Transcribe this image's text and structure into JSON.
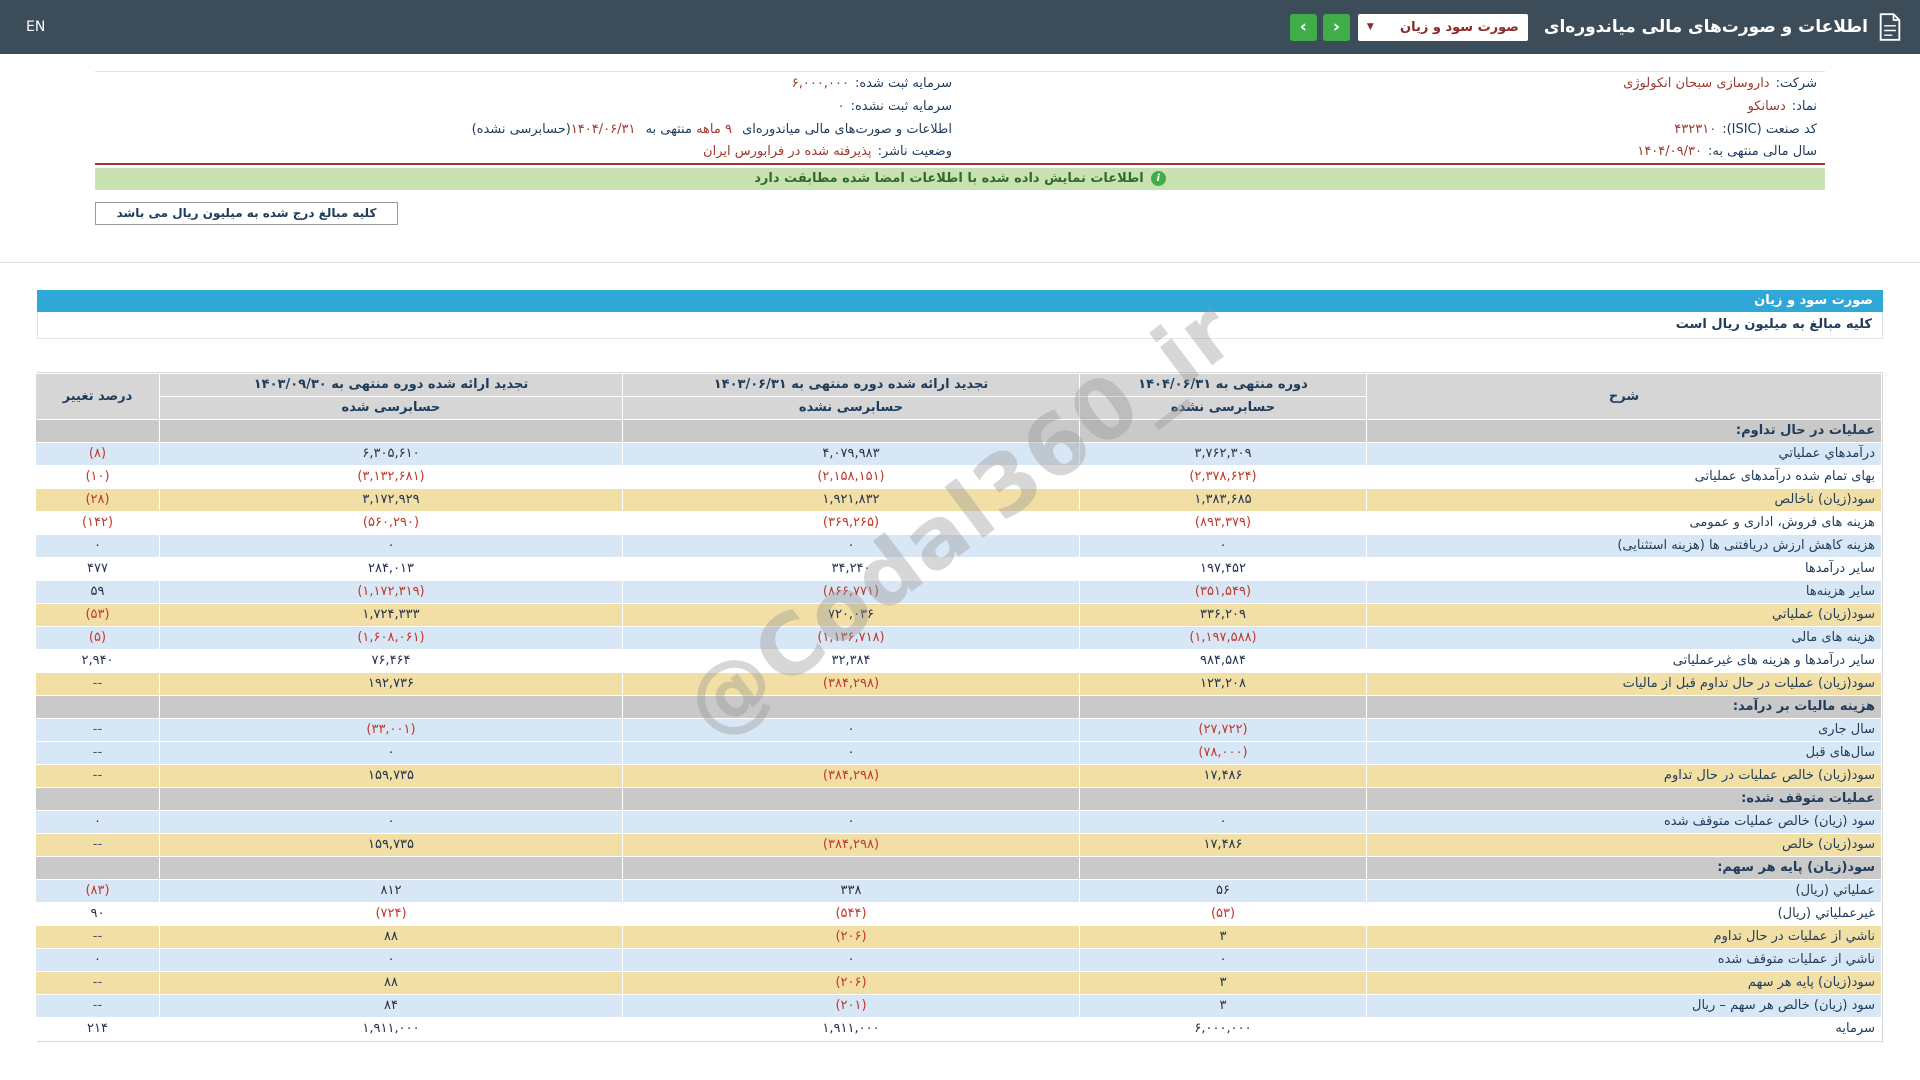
{
  "topbar": {
    "title": "اطلاعات و صورت‌های مالی میاندوره‌ای",
    "dropdown_value": "صورت سود و زیان",
    "lang": "EN"
  },
  "icons": {
    "caret_down": "▼",
    "chevron_left": "‹",
    "chevron_right": "›",
    "info": "i"
  },
  "info_rows": [
    {
      "right": {
        "label": "شرکت:",
        "value": "داروسازی سبحان انکولوژی"
      },
      "left": {
        "label": "سرمایه ثبت شده:",
        "value": "۶,۰۰۰,۰۰۰"
      }
    },
    {
      "right": {
        "label": "نماد:",
        "value": "دسانکو"
      },
      "left": {
        "label": "سرمایه ثبت نشده:",
        "value": "۰"
      }
    },
    {
      "right": {
        "label": "کد صنعت (ISIC):",
        "value": "۴۳۲۳۱۰"
      },
      "left": {
        "parts": [
          {
            "t": "اطلاعات و صورت‌های مالی میاندوره‌ای ",
            "c": "label"
          },
          {
            "t": "۹ ماهه",
            "c": "value"
          },
          {
            "t": " منتهی به ",
            "c": "label"
          },
          {
            "t": "۱۴۰۴/۰۶/۳۱",
            "c": "value"
          },
          {
            "t": "(حسابرسی نشده)",
            "c": "label"
          }
        ]
      }
    },
    {
      "right": {
        "label": "سال مالی منتهی به:",
        "value": "۱۴۰۴/۰۹/۳۰"
      },
      "left": {
        "label": "وضعیت ناشر:",
        "value": "پذیرفته شده در فرابورس ایران"
      }
    }
  ],
  "banner": {
    "text": "اطلاعات نمایش داده شده با اطلاعات امضا شده مطابقت دارد"
  },
  "note": {
    "text": "کلیه مبالغ درج شده به میلیون ریال می باشد"
  },
  "statement": {
    "title": "صورت سود و زیان",
    "unit_note": "کلیه مبالغ به میلیون ریال است"
  },
  "statement_table": {
    "header": {
      "col_desc": "شرح",
      "periods": [
        {
          "title": "دوره منتهی به ۱۴۰۴/۰۶/۳۱",
          "sub": "حسابرسی نشده"
        },
        {
          "title": "تجدید ارائه شده دوره منتهی به ۱۴۰۳/۰۶/۳۱",
          "sub": "حسابرسی نشده"
        },
        {
          "title": "تجدید ارائه شده دوره منتهی به ۱۴۰۳/۰۹/۳۰",
          "sub": "حسابرسی شده"
        }
      ],
      "col_change": "درصد تغییر"
    },
    "rows": [
      {
        "type": "section",
        "label": "عملیات در حال تداوم:"
      },
      {
        "type": "data",
        "style": "blue",
        "label": "درآمدهاي عملياتي",
        "values": [
          "۳,۷۶۲,۳۰۹",
          "۴,۰۷۹,۹۸۳",
          "۶,۳۰۵,۶۱۰"
        ],
        "change": "(۸)"
      },
      {
        "type": "data",
        "style": "white",
        "label": "بهای تمام شده درآمدهای عملیاتی",
        "values": [
          "(۲,۳۷۸,۶۲۴)",
          "(۲,۱۵۸,۱۵۱)",
          "(۳,۱۳۲,۶۸۱)"
        ],
        "change": "(۱۰)"
      },
      {
        "type": "data",
        "style": "yellow",
        "label": "سود(زیان) ناخالص",
        "values": [
          "۱,۳۸۳,۶۸۵",
          "۱,۹۲۱,۸۳۲",
          "۳,۱۷۲,۹۲۹"
        ],
        "change": "(۲۸)"
      },
      {
        "type": "data",
        "style": "white",
        "label": "هزینه های فروش، اداری و عمومی",
        "values": [
          "(۸۹۳,۳۷۹)",
          "(۳۶۹,۲۶۵)",
          "(۵۶۰,۲۹۰)"
        ],
        "change": "(۱۴۲)"
      },
      {
        "type": "data",
        "style": "blue",
        "label": "هزینه کاهش ارزش دریافتنی ها (هزینه استثنایی)",
        "values": [
          "۰",
          "۰",
          "۰"
        ],
        "change": "۰"
      },
      {
        "type": "data",
        "style": "white",
        "label": "سایر درآمدها",
        "values": [
          "۱۹۷,۴۵۲",
          "۳۴,۲۴۰",
          "۲۸۴,۰۱۳"
        ],
        "change": "۴۷۷"
      },
      {
        "type": "data",
        "style": "blue",
        "label": "سایر هزینه‌ها",
        "values": [
          "(۳۵۱,۵۴۹)",
          "(۸۶۶,۷۷۱)",
          "(۱,۱۷۲,۳۱۹)"
        ],
        "change": "۵۹"
      },
      {
        "type": "data",
        "style": "yellow",
        "label": "سود(زیان) عملیاتي",
        "values": [
          "۳۳۶,۲۰۹",
          "۷۲۰,۰۳۶",
          "۱,۷۲۴,۳۳۳"
        ],
        "change": "(۵۳)"
      },
      {
        "type": "data",
        "style": "blue",
        "label": "هزینه های مالی",
        "values": [
          "(۱,۱۹۷,۵۸۸)",
          "(۱,۱۳۶,۷۱۸)",
          "(۱,۶۰۸,۰۶۱)"
        ],
        "change": "(۵)"
      },
      {
        "type": "data",
        "style": "white",
        "label": "سایر درآمدها و هزینه های غیرعملیاتی",
        "values": [
          "۹۸۴,۵۸۴",
          "۳۲,۳۸۴",
          "۷۶,۴۶۴"
        ],
        "change": "۲,۹۴۰"
      },
      {
        "type": "data",
        "style": "yellow",
        "label": "سود(زیان) عملیات در حال تداوم قبل از مالیات",
        "values": [
          "۱۲۳,۲۰۸",
          "(۳۸۴,۲۹۸)",
          "۱۹۲,۷۳۶"
        ],
        "change": "--"
      },
      {
        "type": "section",
        "label": "هزینه مالیات بر درآمد:"
      },
      {
        "type": "data",
        "style": "blue",
        "label": "سال جاری",
        "values": [
          "(۲۷,۷۲۲)",
          "۰",
          "(۳۳,۰۰۱)"
        ],
        "change": "--"
      },
      {
        "type": "data",
        "style": "blue",
        "label": "سال‌های قبل",
        "values": [
          "(۷۸,۰۰۰)",
          "۰",
          "۰"
        ],
        "change": "--"
      },
      {
        "type": "data",
        "style": "yellow",
        "label": "سود(زیان) خالص عملیات در حال تداوم",
        "values": [
          "۱۷,۴۸۶",
          "(۳۸۴,۲۹۸)",
          "۱۵۹,۷۳۵"
        ],
        "change": "--"
      },
      {
        "type": "section",
        "label": "عملیات متوقف شده:"
      },
      {
        "type": "data",
        "style": "blue",
        "label": "سود (زیان) خالص عملیات متوقف شده",
        "values": [
          "۰",
          "۰",
          "۰"
        ],
        "change": "۰"
      },
      {
        "type": "data",
        "style": "yellow",
        "label": "سود(زیان) خالص",
        "values": [
          "۱۷,۴۸۶",
          "(۳۸۴,۲۹۸)",
          "۱۵۹,۷۳۵"
        ],
        "change": "--"
      },
      {
        "type": "section",
        "label": "سود(زیان) پایه هر سهم:"
      },
      {
        "type": "data",
        "style": "blue",
        "label": "عملیاتي (ریال)",
        "values": [
          "۵۶",
          "۳۳۸",
          "۸۱۲"
        ],
        "change": "(۸۳)"
      },
      {
        "type": "data",
        "style": "white",
        "label": "غیرعملیاتي (ریال)",
        "values": [
          "(۵۳)",
          "(۵۴۴)",
          "(۷۲۴)"
        ],
        "change": "۹۰"
      },
      {
        "type": "data",
        "style": "yellow",
        "label": "ناشي از عملیات در حال تداوم",
        "values": [
          "۳",
          "(۲۰۶)",
          "۸۸"
        ],
        "change": "--"
      },
      {
        "type": "data",
        "style": "blue",
        "label": "ناشي از عملیات متوقف شده",
        "values": [
          "۰",
          "۰",
          "۰"
        ],
        "change": "۰"
      },
      {
        "type": "data",
        "style": "yellow",
        "label": "سود(زیان) پایه هر سهم",
        "values": [
          "۳",
          "(۲۰۶)",
          "۸۸"
        ],
        "change": "--"
      },
      {
        "type": "data",
        "style": "blue",
        "label": "سود (زیان) خالص هر سهم – ریال",
        "values": [
          "۳",
          "(۲۰۱)",
          "۸۴"
        ],
        "change": "--"
      },
      {
        "type": "data",
        "style": "white",
        "label": "سرمایه",
        "values": [
          "۶,۰۰۰,۰۰۰",
          "۱,۹۱۱,۰۰۰",
          "۱,۹۱۱,۰۰۰"
        ],
        "change": "۲۱۴"
      }
    ]
  },
  "watermark": "@Codal360_ir",
  "colors": {
    "topbar_bg": "#3c4c59",
    "accent_blue": "#2fa8d7",
    "green": "#3fae49",
    "banner_green_bg": "#c9e2b2",
    "negative_red": "#c0392b",
    "navy_text": "#1f3c5a",
    "maroon_value": "#9e3a2e",
    "row_blue": "#d8e7f5",
    "row_yellow": "#f1dfa5",
    "row_section_gray": "#c9c9c9",
    "header_gray": "#d6d6d6",
    "red_rule": "#9c3a38"
  }
}
